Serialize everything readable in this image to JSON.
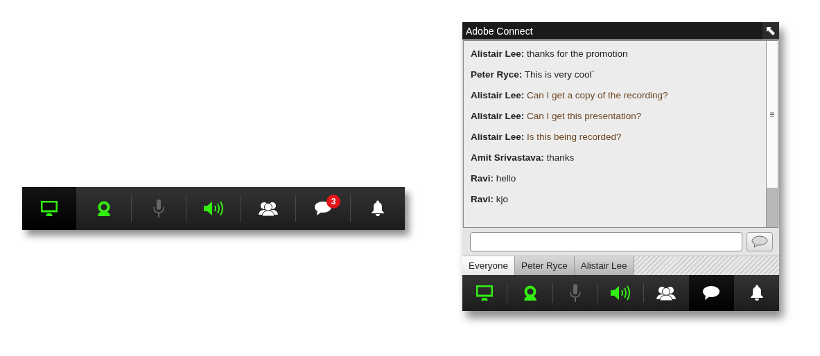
{
  "left_toolbar": {
    "buttons": [
      {
        "kind": "screen",
        "on": true,
        "disabled": false,
        "selected": true
      },
      {
        "kind": "camera",
        "on": true,
        "disabled": false,
        "selected": false
      },
      {
        "kind": "mic",
        "on": false,
        "disabled": true,
        "selected": false
      },
      {
        "kind": "speaker",
        "on": true,
        "disabled": false,
        "selected": false
      },
      {
        "kind": "people",
        "on": false,
        "disabled": false,
        "selected": false
      },
      {
        "kind": "chat",
        "on": false,
        "disabled": false,
        "selected": false,
        "badge": "3"
      },
      {
        "kind": "bell",
        "on": false,
        "disabled": false,
        "selected": false
      }
    ]
  },
  "chat_window": {
    "title": "Adobe Connect",
    "messages": [
      {
        "sender": "Alistair Lee:",
        "text": "thanks for the promotion",
        "highlighted": false
      },
      {
        "sender": "Peter Ryce:",
        "text": "This is very cool`",
        "highlighted": false
      },
      {
        "sender": "Alistair Lee:",
        "text": "Can I get a copy of the recording?",
        "highlighted": true
      },
      {
        "sender": "Alistair Lee:",
        "text": "Can I get this presentation?",
        "highlighted": true
      },
      {
        "sender": "Alistair Lee:",
        "text": "Is this being recorded?",
        "highlighted": true
      },
      {
        "sender": "Amit Srivastava:",
        "text": "thanks",
        "highlighted": false
      },
      {
        "sender": "Ravi:",
        "text": "hello",
        "highlighted": false
      },
      {
        "sender": "Ravi:",
        "text": "kjo",
        "highlighted": false
      }
    ],
    "tabs": [
      {
        "label": "Everyone",
        "selected": true
      },
      {
        "label": "Peter Ryce",
        "selected": false
      },
      {
        "label": "Alistair Lee",
        "selected": false
      }
    ],
    "toolbar": {
      "buttons": [
        {
          "kind": "screen",
          "on": true,
          "disabled": false,
          "selected": false
        },
        {
          "kind": "camera",
          "on": true,
          "disabled": false,
          "selected": false
        },
        {
          "kind": "mic",
          "on": false,
          "disabled": true,
          "selected": false
        },
        {
          "kind": "speaker",
          "on": true,
          "disabled": false,
          "selected": false
        },
        {
          "kind": "people",
          "on": false,
          "disabled": false,
          "selected": false
        },
        {
          "kind": "chat",
          "on": false,
          "disabled": false,
          "selected": true
        },
        {
          "kind": "bell",
          "on": false,
          "disabled": false,
          "selected": false
        }
      ]
    }
  }
}
